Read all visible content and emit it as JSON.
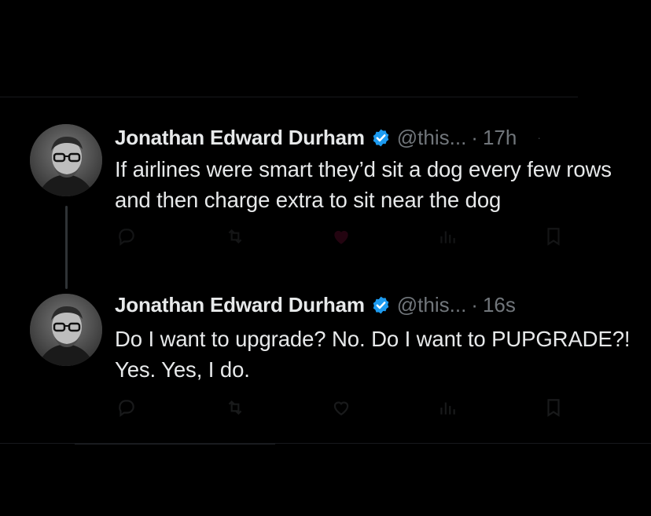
{
  "tweets": [
    {
      "author_name": "Jonathan Edward Durham",
      "handle": "@this...",
      "separator": "·",
      "time": "17h",
      "text": "If airlines were smart they’d sit a dog every few rows and then charge extra to sit near the dog"
    },
    {
      "author_name": "Jonathan Edward Durham",
      "handle": "@this...",
      "separator": "·",
      "time": "16s",
      "text": "Do I want to upgrade? No. Do I want to PUPGRADE?! Yes. Yes, I do."
    }
  ],
  "icons": {
    "verified": "verified-badge-icon",
    "reply": "reply-icon",
    "repost": "repost-icon",
    "like": "heart-icon",
    "views": "views-icon",
    "bookmark": "bookmark-icon",
    "more": "more-icon"
  },
  "colors": {
    "background": "#000000",
    "text": "#e7e9ea",
    "muted": "#71767b",
    "verified": "#1d9bf0",
    "divider": "#16181c"
  }
}
